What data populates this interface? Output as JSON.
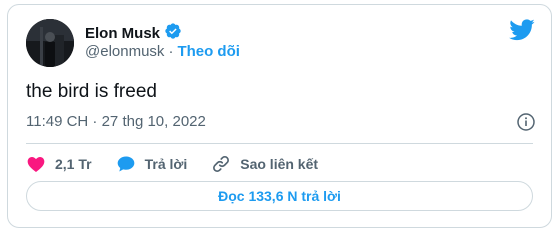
{
  "user": {
    "name": "Elon Musk",
    "handle": "@elonmusk",
    "separator": "·",
    "follow_label": "Theo dõi"
  },
  "icons": {
    "verified": "verified-badge-icon",
    "logo": "twitter-bird-icon",
    "info": "info-icon",
    "like": "heart-icon",
    "reply": "speech-bubble-icon",
    "copy_link": "chain-link-icon"
  },
  "tweet": {
    "text": "the bird is freed",
    "timestamp": "11:49 CH · 27 thg 10, 2022"
  },
  "actions": {
    "like_count": "2,1 Tr",
    "reply_label": "Trả lời",
    "copy_link_label": "Sao liên kết"
  },
  "read_replies_label": "Đọc 133,6 N trả lời",
  "colors": {
    "accent": "#1d9bf0",
    "like": "#f91880",
    "text": "#0f1419",
    "secondary": "#536471",
    "border": "#cfd9de"
  }
}
